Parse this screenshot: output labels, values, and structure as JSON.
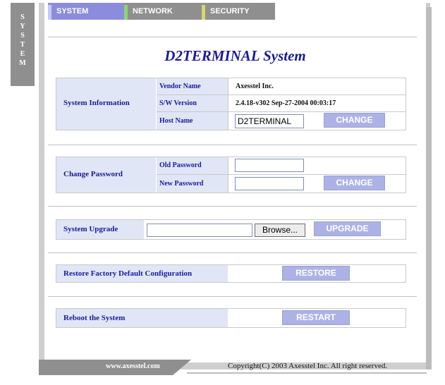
{
  "side_label": [
    "S",
    "Y",
    "S",
    "T",
    "E",
    "M"
  ],
  "tabs": {
    "system": "SYSTEM",
    "network": "NETWORK",
    "security": "SECURITY"
  },
  "title": "D2TERMINAL System",
  "system_information": {
    "label": "System Information",
    "vendor_name_label": "Vendor Name",
    "vendor_name_value": "Axesstel Inc.",
    "sw_version_label": "S/W Version",
    "sw_version_value": "2.4.18-v302 Sep-27-2004 00:03:17",
    "host_name_label": "Host Name",
    "host_name_value": "D2TERMINAL",
    "change_button": "CHANGE"
  },
  "change_password": {
    "label": "Change Password",
    "old_password_label": "Old Password",
    "new_password_label": "New Password",
    "old_password_value": "",
    "new_password_value": "",
    "change_button": "CHANGE"
  },
  "system_upgrade": {
    "label": "System Upgrade",
    "file_value": "",
    "browse_button": "Browse...",
    "upgrade_button": "UPGRADE"
  },
  "restore": {
    "label": "Restore Factory Default Configuration",
    "button": "RESTORE"
  },
  "reboot": {
    "label": "Reboot the System",
    "button": "RESTART"
  },
  "footer": {
    "site": "www.axesstel.com",
    "copyright": "Copyright(C) 2003 Axesstel Inc. All right reserved."
  },
  "colors": {
    "title": "#1a1a9a",
    "label_bg": "#e0e6f5",
    "button_bg": "#adb2e6",
    "tab_active": "#8c8cdc",
    "tab_inactive": "#8f8f8f"
  }
}
